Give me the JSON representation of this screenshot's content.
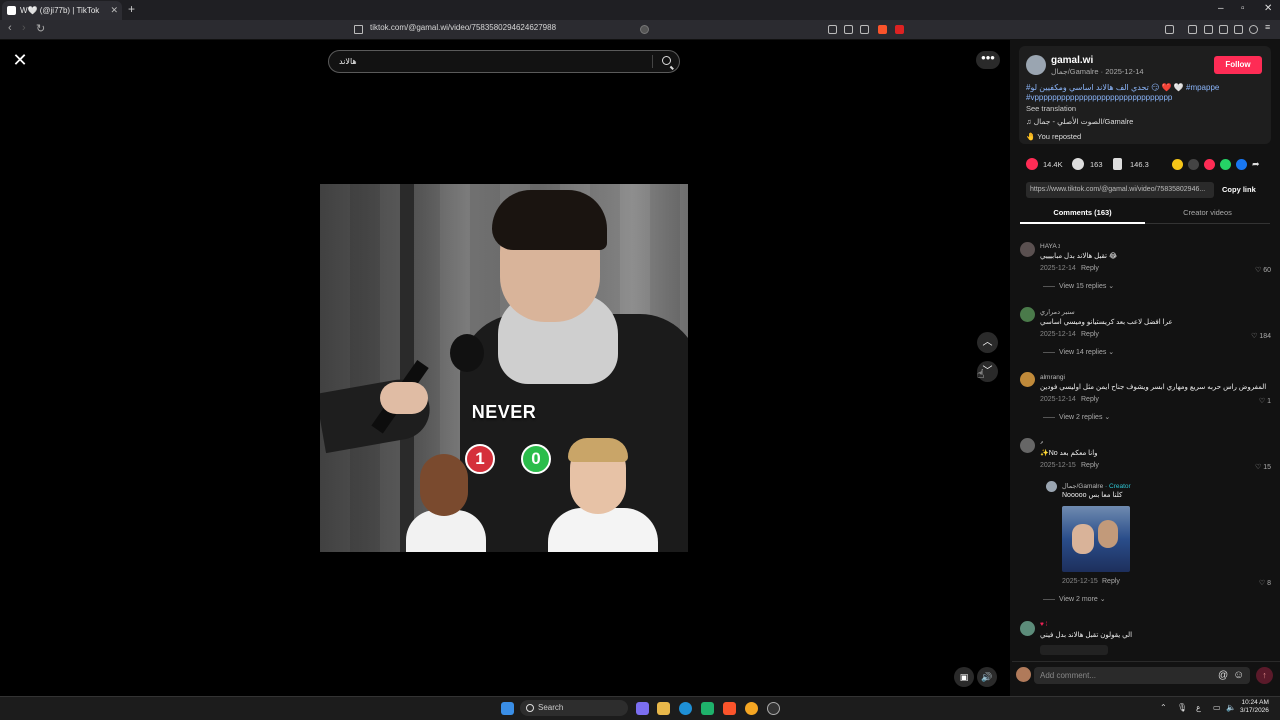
{
  "browser": {
    "tab_title": "W🤍 (@ji77b) | TikTok",
    "new_tab": "+",
    "url": "tiktok.com/@gamal.wi/video/7583580294624627988"
  },
  "video": {
    "search_value": "هالاند",
    "overlay_text": "NEVER",
    "score_left": "1",
    "score_right": "0"
  },
  "author": {
    "username": "gamal.wi",
    "subline": "جمال/Gamalre · 2025-12-14",
    "follow_label": "Follow",
    "caption_line1": "#تحدي الف هالاند اساسي ومكفيين لو 😏 ❤️ 🤍 #mpappe",
    "caption_line2": "#vppppppppppppppppppppppppppppppp",
    "see_translation": "See translation",
    "music": "♫  الصوت الأصلي - جمال/Gamalre",
    "reposted": "You reposted"
  },
  "stats": {
    "likes": "14.4K",
    "comments": "163",
    "saves": "146.3"
  },
  "share": {
    "link": "https://www.tiktok.com/@gamal.wi/video/75835802946...",
    "copy_label": "Copy link"
  },
  "tabs": {
    "comments": "Comments (163)",
    "creator_videos": "Creator videos"
  },
  "comments": [
    {
      "name": "HAYA ܐ",
      "text": "تقبل هالاند بدل مبابيييي 😂",
      "date": "2025-12-14",
      "reply": "Reply",
      "likes": "60",
      "view": "View 15 replies ⌄"
    },
    {
      "name": "سنبر دمراري",
      "text": "عرا افضل لاعب بعد كريستيانو وميسي اساسي",
      "date": "2025-12-14",
      "reply": "Reply",
      "likes": "184",
      "view": "View 14 replies ⌄"
    },
    {
      "name": "almrangi",
      "text": "المفروض راس حربه سريع ومهاري ابسر ويشوف جناح ايمن مثل اوليسي فودين",
      "date": "2025-12-14",
      "reply": "Reply",
      "likes": "1",
      "view": "View 2 replies ⌄"
    },
    {
      "name": "ޥ",
      "text": "✨No وانا معكم بعد",
      "date": "2025-12-15",
      "reply": "Reply",
      "likes": "15",
      "view": ""
    },
    {
      "name": "جمال/Gamalre",
      "creator_tag": " · Creator",
      "text": "Nooooo كلنا معا بس",
      "date": "2025-12-15",
      "reply": "Reply",
      "likes": "8",
      "view": "View 2 more ⌄"
    },
    {
      "name": "♥ ⁞",
      "text": "الي يقولون تقبل هالاند بدل فيني",
      "date": "",
      "reply": "",
      "likes": "",
      "view": ""
    }
  ],
  "comment_input": {
    "placeholder": "Add comment...",
    "at": "@",
    "emoji": "☺",
    "send": "↑"
  },
  "taskbar": {
    "search": "Search",
    "time": "10:24 AM",
    "date": "3/17/2026"
  },
  "colors": {
    "accent": "#fe2c55",
    "hashtag": "#8ab4f8",
    "creator": "#2ec5d3"
  }
}
